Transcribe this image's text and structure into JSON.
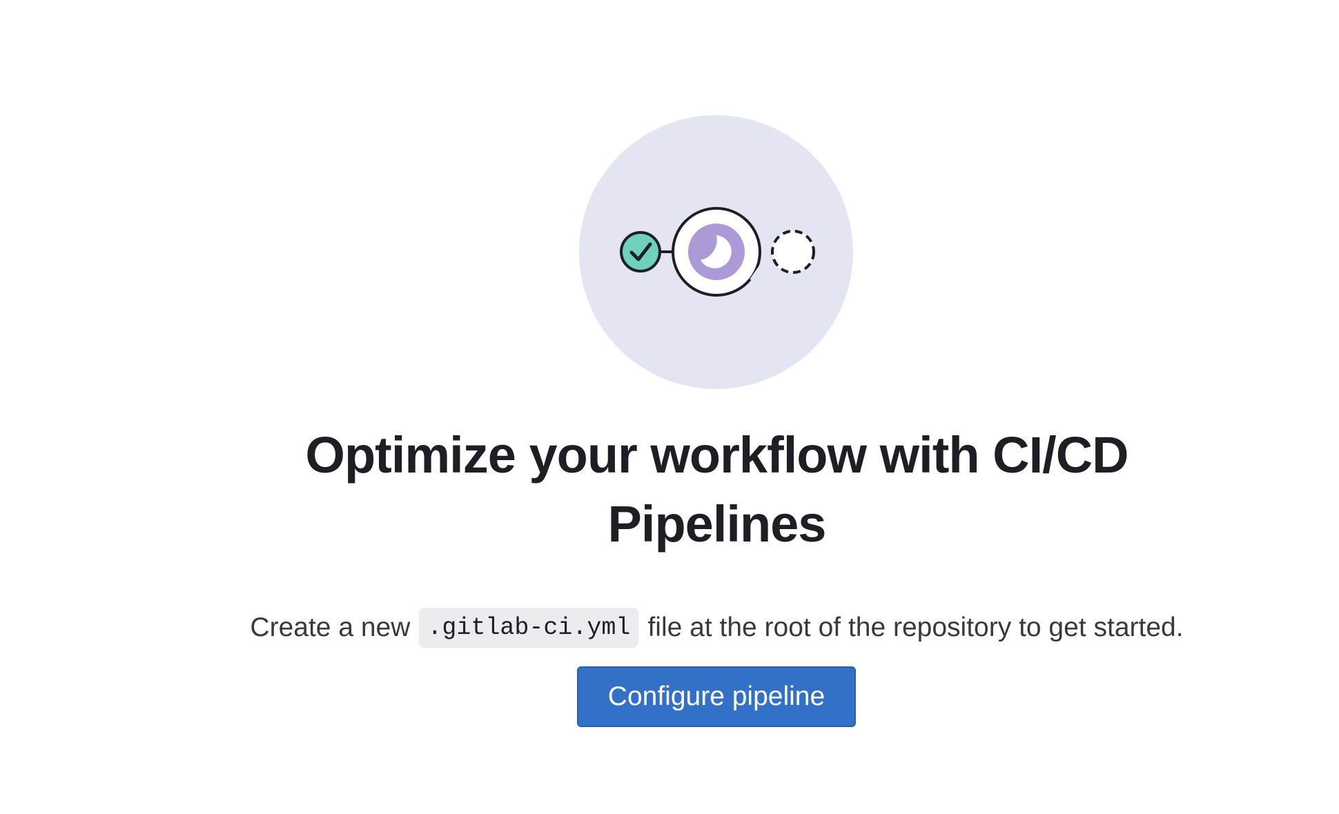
{
  "empty_state": {
    "illustration": {
      "icon": "pipeline-illustration",
      "background_color": "#e5e4f2",
      "success_color": "#6ed1bd",
      "running_color": "#ac9ad7",
      "stroke_color": "#1f1e24"
    },
    "title": "Optimize your workflow with CI/CD Pipelines",
    "description": {
      "before": "Create a new",
      "code": ".gitlab-ci.yml",
      "after": "file at the root of the repository to get started."
    },
    "button": {
      "label": "Configure pipeline",
      "color": "#3371c8"
    }
  }
}
